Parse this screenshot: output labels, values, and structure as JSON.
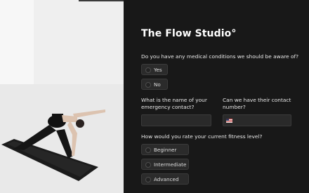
{
  "studio": {
    "title": "The Flow Studio°"
  },
  "question_medical": {
    "label": "Do you have any medical conditions we should be aware of?",
    "options": [
      "Yes",
      "No"
    ]
  },
  "emergency_contact": {
    "name_label": "What is the name of your emergency contact?",
    "name_value": "",
    "number_label": "Can we have their contact number?",
    "number_value": ""
  },
  "fitness": {
    "label": "How would you rate your current fitness level?",
    "options": [
      "Beginner",
      "Intermediate",
      "Advanced"
    ]
  }
}
